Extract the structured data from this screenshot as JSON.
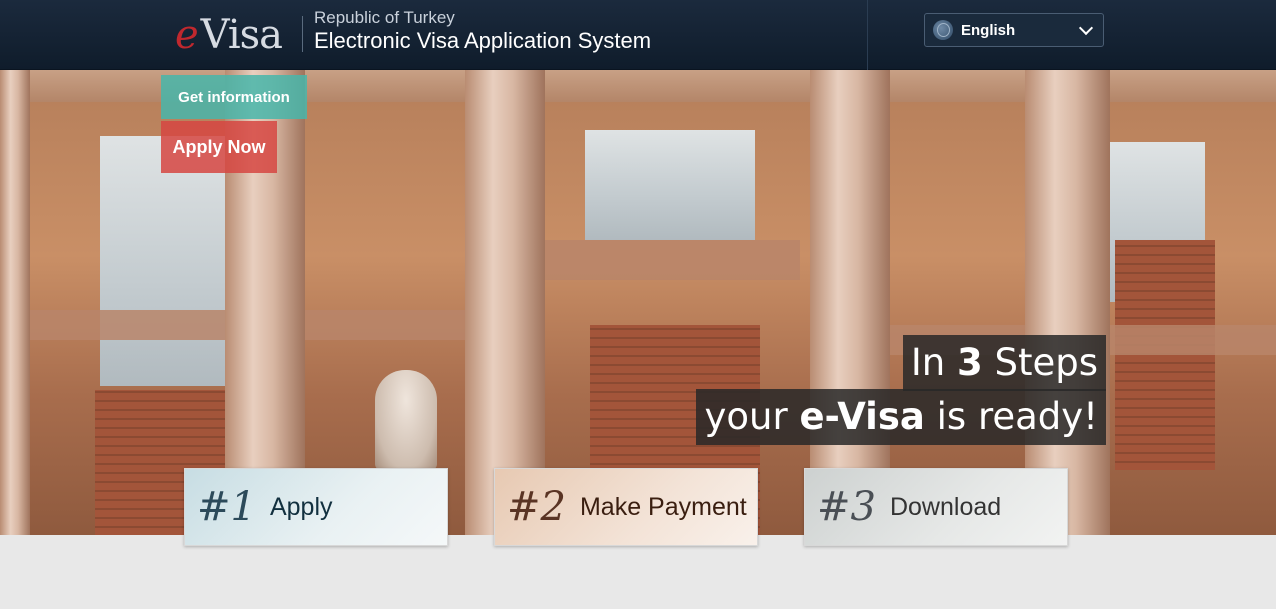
{
  "header": {
    "logo_e": "e",
    "logo_visa": "Visa",
    "subtitle": "Republic of Turkey",
    "title": "Electronic Visa Application System",
    "language": {
      "selected": "English",
      "icon": "globe-icon"
    }
  },
  "hero": {
    "get_info_label": "Get information",
    "apply_now_label": "Apply Now",
    "tagline": {
      "line1_prefix": "In ",
      "line1_bold": "3",
      "line1_suffix": " Steps",
      "line2_prefix": "your ",
      "line2_bold": "e-Visa",
      "line2_suffix": " is ready!"
    }
  },
  "steps": [
    {
      "number": "#1",
      "label": "Apply"
    },
    {
      "number": "#2",
      "label": "Make Payment"
    },
    {
      "number": "#3",
      "label": "Download"
    }
  ],
  "colors": {
    "header_bg": "#142234",
    "brand_red": "#c0282e",
    "get_info_bg": "#48b6aa",
    "apply_now_bg": "#d64642"
  }
}
